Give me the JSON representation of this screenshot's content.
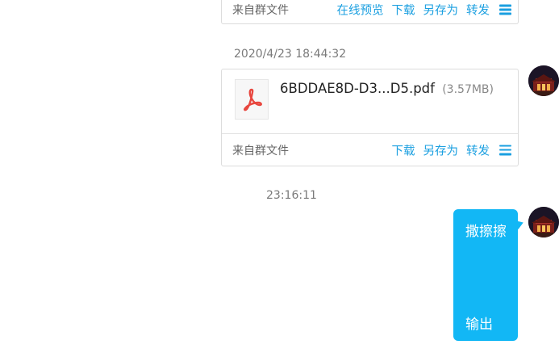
{
  "messages": [
    {
      "source": "来自群文件",
      "actions": [
        "在线预览",
        "下载",
        "另存为",
        "转发"
      ]
    },
    {
      "timestamp": "2020/4/23 18:44:32",
      "file": {
        "name": "6BDDAE8D-D3...D5.pdf",
        "size": "(3.57MB)",
        "icon": "pdf-icon"
      },
      "source": "来自群文件",
      "actions": [
        "下载",
        "另存为",
        "转发"
      ]
    },
    {
      "timestamp": "23:16:11",
      "text_lines": [
        "撒擦擦",
        "输出"
      ]
    }
  ],
  "colors": {
    "link": "#1a9fe0",
    "bubble": "#12b7f5",
    "pdf": "#e8473f"
  }
}
